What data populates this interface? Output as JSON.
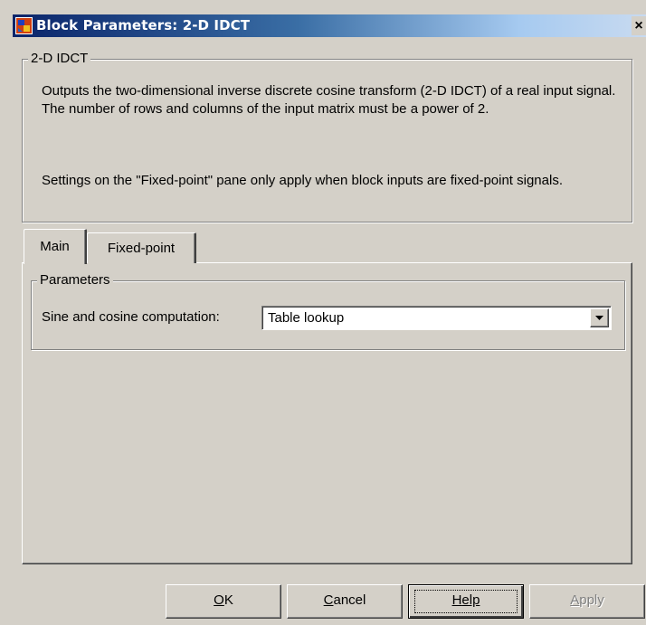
{
  "window": {
    "title": "Block Parameters: 2-D IDCT",
    "close_glyph": "×"
  },
  "description": {
    "group_label": "2-D IDCT",
    "paragraph1": "Outputs the two-dimensional inverse discrete cosine transform (2-D IDCT) of a real input signal. The number of rows and columns of the input matrix must be a power of 2.",
    "paragraph2": "Settings on the \"Fixed-point\" pane only apply when block inputs are fixed-point signals."
  },
  "tabs": [
    {
      "label": "Main",
      "selected": true
    },
    {
      "label": "Fixed-point",
      "selected": false
    }
  ],
  "parameters": {
    "group_label": "Parameters",
    "sine_cosine_label": "Sine and cosine computation:",
    "sine_cosine_value": "Table lookup"
  },
  "buttons": {
    "ok": {
      "mnemonic": "O",
      "rest": "K"
    },
    "cancel": {
      "mnemonic": "C",
      "rest": "ancel"
    },
    "help": {
      "mnemonic": "H",
      "rest": "elp"
    },
    "apply": {
      "mnemonic": "A",
      "rest": "pply"
    }
  },
  "icons": {
    "title": "simulink-block-icon",
    "close": "close-icon",
    "dropdown": "chevron-down-icon"
  },
  "colors": {
    "face": "#d4d0c8",
    "titlebar_start": "#0a246a",
    "titlebar_end": "#a6caf0"
  }
}
